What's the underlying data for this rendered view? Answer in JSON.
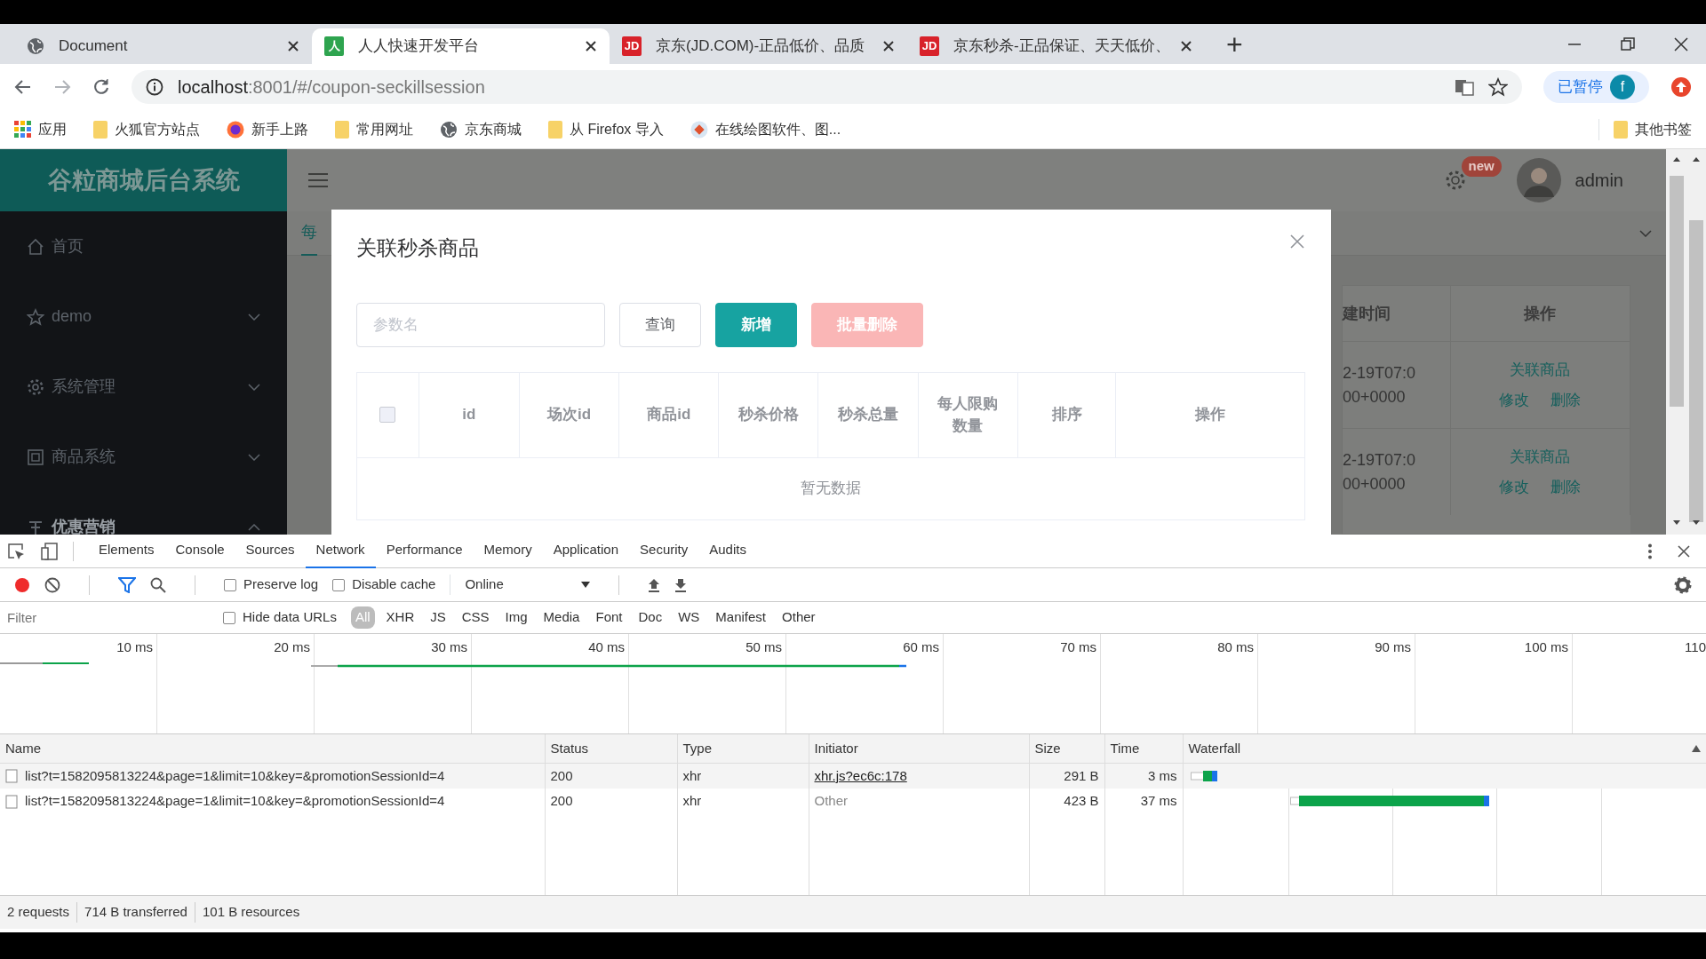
{
  "browser": {
    "tabs": [
      {
        "title": "Document",
        "selected": false
      },
      {
        "title": "人人快速开发平台",
        "favicon": {
          "text": "人",
          "color": "#2ea44f"
        },
        "selected": true
      },
      {
        "title": "京东(JD.COM)-正品低价、品质",
        "favicon": {
          "text": "JD",
          "color": "#d8222a"
        },
        "selected": false
      },
      {
        "title": "京东秒杀-正品保证、天天低价、",
        "favicon": {
          "text": "JD",
          "color": "#d8222a"
        },
        "selected": false
      }
    ],
    "new_tab": "+",
    "address": {
      "host": "localhost",
      "path": ":8001/#/coupon-seckillsession"
    },
    "profile": {
      "label": "已暂停",
      "avatar": "f"
    },
    "bookmarks": [
      {
        "label": "应用"
      },
      {
        "label": "火狐官方站点"
      },
      {
        "label": "新手上路"
      },
      {
        "label": "常用网址"
      },
      {
        "label": "京东商城"
      },
      {
        "label": "从 Firefox 导入"
      },
      {
        "label": "在线绘图软件、图..."
      }
    ],
    "other_bookmarks": "其他书签"
  },
  "app": {
    "logo": "谷粒商城后台系统",
    "menu": [
      {
        "label": "首页"
      },
      {
        "label": "demo",
        "expanded": false
      },
      {
        "label": "系统管理",
        "expanded": false
      },
      {
        "label": "商品系统",
        "expanded": false
      },
      {
        "label": "优惠营销",
        "expanded": true
      }
    ],
    "header": {
      "badge": "new",
      "user": "admin"
    },
    "page_tab": "每",
    "table": {
      "columns": [
        "建时间",
        "操作"
      ],
      "rows": [
        {
          "date": [
            "2-19T07:0",
            "00+0000"
          ],
          "actions": [
            "关联商品",
            "修改",
            "删除"
          ]
        },
        {
          "date": [
            "2-19T07:0",
            "00+0000"
          ],
          "actions": [
            "关联商品",
            "修改",
            "删除"
          ]
        }
      ]
    }
  },
  "modal": {
    "title": "关联秒杀商品",
    "search": {
      "placeholder": "参数名"
    },
    "buttons": [
      {
        "label": "查询",
        "kind": "default",
        "disabled": false
      },
      {
        "label": "新增",
        "kind": "primary",
        "disabled": false
      },
      {
        "label": "批量删除",
        "kind": "danger",
        "disabled": true
      }
    ],
    "table": {
      "select_all_checked": false,
      "columns": [
        "id",
        "场次id",
        "商品id",
        "秒杀价格",
        "秒杀总量",
        "每人限购数量",
        "排序",
        "操作"
      ],
      "empty_text": "暂无数据"
    }
  },
  "devtools": {
    "panel_tabs": [
      {
        "label": "Elements",
        "selected": false
      },
      {
        "label": "Console",
        "selected": false
      },
      {
        "label": "Sources",
        "selected": false
      },
      {
        "label": "Network",
        "selected": true
      },
      {
        "label": "Performance",
        "selected": false
      },
      {
        "label": "Memory",
        "selected": false
      },
      {
        "label": "Application",
        "selected": false
      },
      {
        "label": "Security",
        "selected": false
      },
      {
        "label": "Audits",
        "selected": false
      }
    ],
    "toolbar": {
      "recording": true,
      "preserve_log": {
        "label": "Preserve log",
        "checked": false
      },
      "disable_cache": {
        "label": "Disable cache",
        "checked": false
      },
      "throttle": "Online"
    },
    "filter": {
      "placeholder": "Filter",
      "hide_data_urls": {
        "label": "Hide data URLs",
        "checked": false
      },
      "types": [
        {
          "label": "All",
          "selected": true
        },
        {
          "label": "XHR",
          "selected": false
        },
        {
          "label": "JS",
          "selected": false
        },
        {
          "label": "CSS",
          "selected": false
        },
        {
          "label": "Img",
          "selected": false
        },
        {
          "label": "Media",
          "selected": false
        },
        {
          "label": "Font",
          "selected": false
        },
        {
          "label": "Doc",
          "selected": false
        },
        {
          "label": "WS",
          "selected": false
        },
        {
          "label": "Manifest",
          "selected": false
        },
        {
          "label": "Other",
          "selected": false
        }
      ]
    },
    "timeline": {
      "ticks": [
        "10 ms",
        "20 ms",
        "30 ms",
        "40 ms",
        "50 ms",
        "60 ms",
        "70 ms",
        "80 ms",
        "90 ms",
        "100 ms",
        "110"
      ]
    },
    "requests": {
      "columns": [
        "Name",
        "Status",
        "Type",
        "Initiator",
        "Size",
        "Time",
        "Waterfall"
      ],
      "rows": [
        {
          "name": "list?t=1582095813224&page=1&limit=10&key=&promotionSessionId=4",
          "status": "200",
          "type": "xhr",
          "initiator": "xhr.js?ec6c:178",
          "initiator_is_link": true,
          "size": "291 B",
          "time": "3 ms"
        },
        {
          "name": "list?t=1582095813224&page=1&limit=10&key=&promotionSessionId=4",
          "status": "200",
          "type": "xhr",
          "initiator": "Other",
          "initiator_is_link": false,
          "size": "423 B",
          "time": "37 ms"
        }
      ]
    },
    "summary": [
      "2 requests",
      "714 B transferred",
      "101 B resources"
    ]
  }
}
